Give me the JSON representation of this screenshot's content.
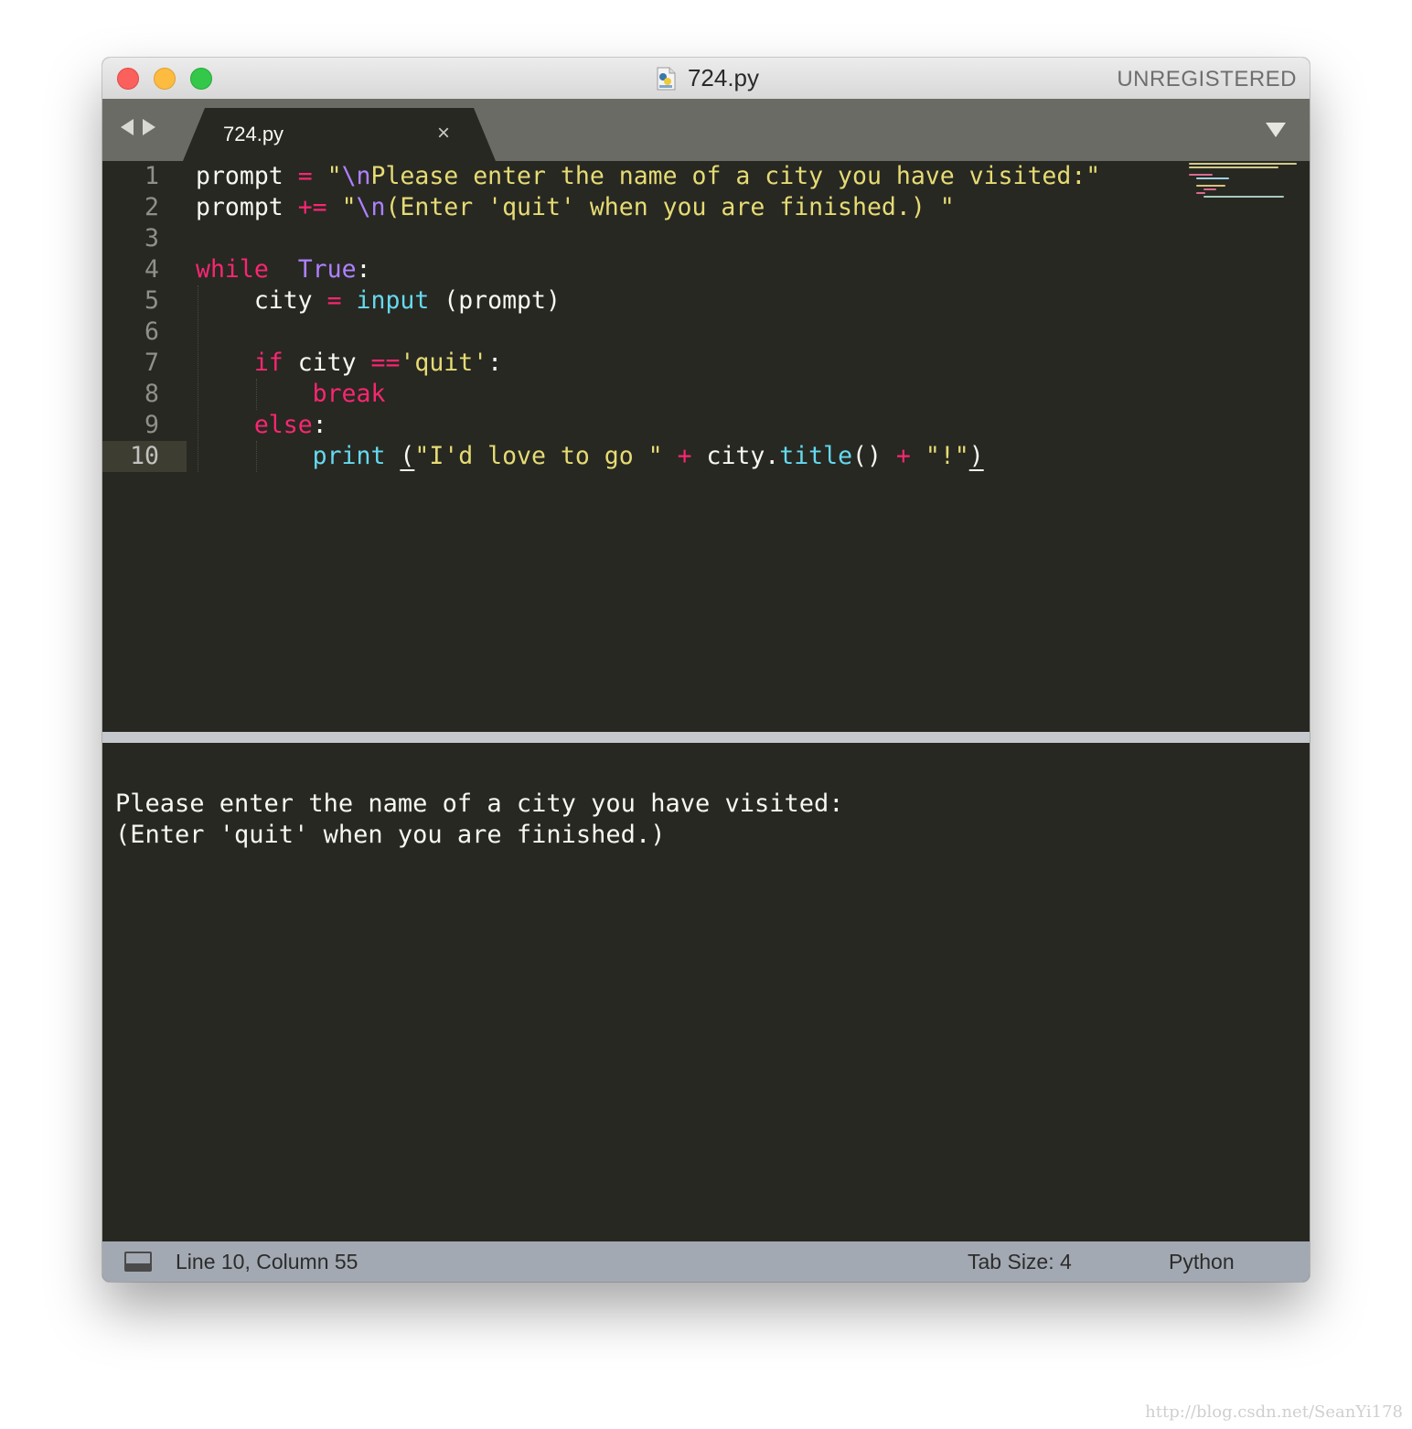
{
  "window": {
    "title": "724.py",
    "registration": "UNREGISTERED"
  },
  "tabs": [
    {
      "label": "724.py",
      "close": "×",
      "active": true
    }
  ],
  "editor": {
    "line_numbers": [
      "1",
      "2",
      "3",
      "4",
      "5",
      "6",
      "7",
      "8",
      "9",
      "10"
    ],
    "active_line": 10,
    "lines": [
      [
        {
          "t": "prompt ",
          "c": "plain"
        },
        {
          "t": "=",
          "c": "op"
        },
        {
          "t": " ",
          "c": "plain"
        },
        {
          "t": "\"",
          "c": "str"
        },
        {
          "t": "\\n",
          "c": "esc"
        },
        {
          "t": "Please enter the name of a city you have visited:\"",
          "c": "str"
        }
      ],
      [
        {
          "t": "prompt ",
          "c": "plain"
        },
        {
          "t": "+=",
          "c": "op"
        },
        {
          "t": " ",
          "c": "plain"
        },
        {
          "t": "\"",
          "c": "str"
        },
        {
          "t": "\\n",
          "c": "esc"
        },
        {
          "t": "(Enter 'quit' when you are finished.) \"",
          "c": "str"
        }
      ],
      [],
      [
        {
          "t": "while",
          "c": "kw"
        },
        {
          "t": "  ",
          "c": "plain"
        },
        {
          "t": "True",
          "c": "const"
        },
        {
          "t": ":",
          "c": "plain"
        }
      ],
      [
        {
          "t": "    city ",
          "c": "plain"
        },
        {
          "t": "=",
          "c": "op"
        },
        {
          "t": " ",
          "c": "plain"
        },
        {
          "t": "input",
          "c": "fn"
        },
        {
          "t": " (prompt)",
          "c": "plain"
        }
      ],
      [],
      [
        {
          "t": "    ",
          "c": "plain"
        },
        {
          "t": "if",
          "c": "kw"
        },
        {
          "t": " city ",
          "c": "plain"
        },
        {
          "t": "==",
          "c": "op"
        },
        {
          "t": "'quit'",
          "c": "str"
        },
        {
          "t": ":",
          "c": "plain"
        }
      ],
      [
        {
          "t": "        ",
          "c": "plain"
        },
        {
          "t": "break",
          "c": "kw"
        }
      ],
      [
        {
          "t": "    ",
          "c": "plain"
        },
        {
          "t": "else",
          "c": "kw"
        },
        {
          "t": ":",
          "c": "plain"
        }
      ],
      [
        {
          "t": "        ",
          "c": "plain"
        },
        {
          "t": "print",
          "c": "fn"
        },
        {
          "t": " ",
          "c": "plain"
        },
        {
          "t": "(",
          "c": "plain uline"
        },
        {
          "t": "\"I'd love to go \"",
          "c": "str"
        },
        {
          "t": " ",
          "c": "plain"
        },
        {
          "t": "+",
          "c": "op"
        },
        {
          "t": " city.",
          "c": "plain"
        },
        {
          "t": "title",
          "c": "fn"
        },
        {
          "t": "() ",
          "c": "plain"
        },
        {
          "t": "+",
          "c": "op"
        },
        {
          "t": " ",
          "c": "plain"
        },
        {
          "t": "\"!\"",
          "c": "str"
        },
        {
          "t": ")",
          "c": "plain uline"
        }
      ]
    ]
  },
  "console": {
    "lines": [
      "",
      "Please enter the name of a city you have visited:",
      "(Enter 'quit' when you are finished.)"
    ]
  },
  "status": {
    "position": "Line 10, Column 55",
    "tab_size": "Tab Size: 4",
    "syntax": "Python"
  },
  "watermark": "http://blog.csdn.net/SeanYi178",
  "colors": {
    "background": "#272822",
    "keyword": "#f92672",
    "string": "#e6db74",
    "constant": "#ae81ff",
    "function": "#66d9ef",
    "text": "#f8f8f2"
  }
}
